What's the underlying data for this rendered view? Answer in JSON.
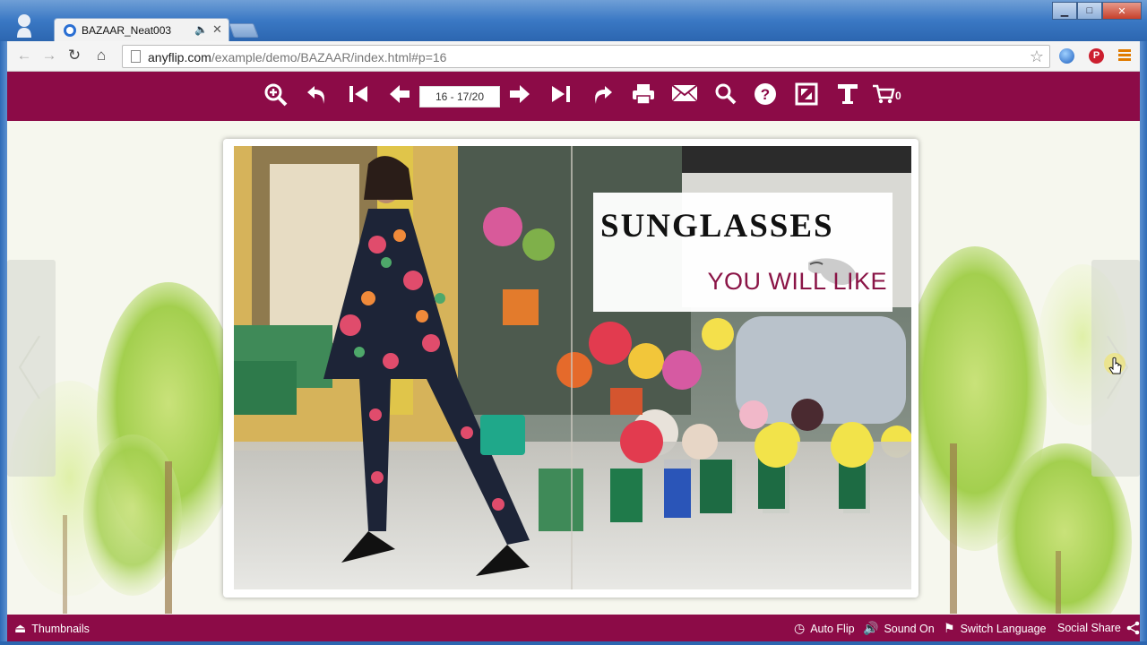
{
  "browser": {
    "tab_title": "BAZAAR_Neat003",
    "tab_audio_icon": "speaker-icon",
    "tab_close": "✕",
    "url_host": "anyflip.com",
    "url_path": "/example/demo/BAZAAR/index.html#p=16",
    "window_controls": {
      "minimize": "▁",
      "maximize": "□",
      "close": "✕"
    }
  },
  "flipbook": {
    "toolbar": {
      "page_field": "16 - 17/20",
      "cart_count": "0",
      "icons": [
        "zoom-in-icon",
        "back-icon",
        "first-page-icon",
        "prev-page-icon",
        "next-page-icon",
        "last-page-icon",
        "share-icon",
        "print-icon",
        "email-icon",
        "search-icon",
        "help-icon",
        "fullscreen-icon",
        "text-icon",
        "cart-icon"
      ]
    },
    "page": {
      "headline": "SUNGLASSES",
      "subheadline": "YOU WILL LIKE"
    },
    "footer": {
      "thumbnails": "Thumbnails",
      "auto_flip": "Auto Flip",
      "sound_on": "Sound On",
      "switch_language": "Switch Language",
      "social_share": "Social Share"
    }
  },
  "colors": {
    "brand": "#8c0b47",
    "background": "#f7f8ef"
  }
}
